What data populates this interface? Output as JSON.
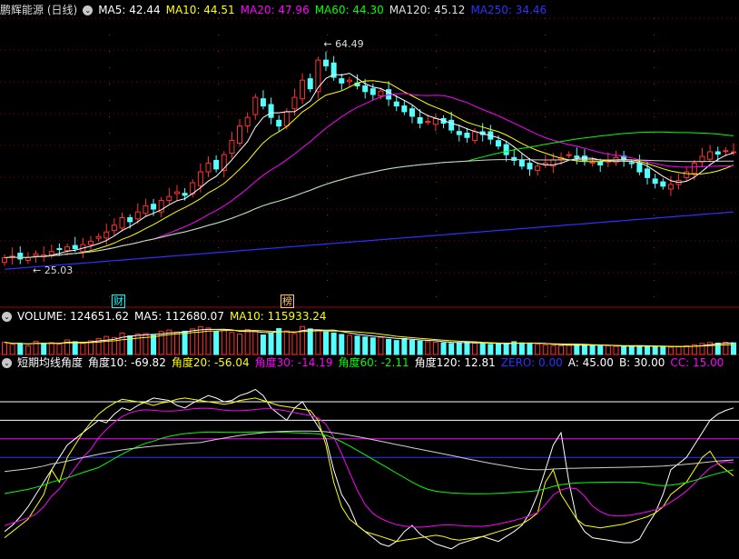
{
  "main": {
    "stock": "鹏辉能源 (日线)",
    "ma": [
      {
        "label": "MA5: 42.44",
        "color": "#ffffff"
      },
      {
        "label": "MA10: 44.51",
        "color": "#ffff00"
      },
      {
        "label": "MA20: 47.96",
        "color": "#ff00ff"
      },
      {
        "label": "MA60: 44.30",
        "color": "#00ff00"
      },
      {
        "label": "MA120: 45.12",
        "color": "#e0e0e0"
      },
      {
        "label": "MA250: 34.46",
        "color": "#3030ff"
      }
    ],
    "high_label": "64.49",
    "low_label": "25.03",
    "tag1": "财",
    "tag2": "榜"
  },
  "volume": {
    "items": [
      {
        "label": "VOLUME: 124651.62",
        "color": "#ffffff"
      },
      {
        "label": "MA5: 112680.07",
        "color": "#ffffff"
      },
      {
        "label": "MA10: 115933.24",
        "color": "#ffff00"
      }
    ]
  },
  "indicator": {
    "items": [
      {
        "label": "短期均线角度",
        "color": "#ffffff"
      },
      {
        "label": "角度10: -69.82",
        "color": "#ffffff"
      },
      {
        "label": "角度20: -56.04",
        "color": "#ffff00"
      },
      {
        "label": "角度30: -14.19",
        "color": "#ff00ff"
      },
      {
        "label": "角度60: -2.11",
        "color": "#00ff00"
      },
      {
        "label": "角度120: 12.81",
        "color": "#ffffff"
      },
      {
        "label": "ZERO: 0.00",
        "color": "#3030ff"
      },
      {
        "label": "A: 45.00",
        "color": "#ffffff"
      },
      {
        "label": "B: 30.00",
        "color": "#ffffff"
      },
      {
        "label": "CC: 15.00",
        "color": "#ff00ff"
      }
    ]
  },
  "chart_data": {
    "type": "candlestick",
    "series": [
      {
        "name": "MA5",
        "last": 42.44
      },
      {
        "name": "MA10",
        "last": 44.51
      },
      {
        "name": "MA20",
        "last": 47.96
      },
      {
        "name": "MA60",
        "last": 44.3
      },
      {
        "name": "MA120",
        "last": 45.12
      },
      {
        "name": "MA250",
        "last": 34.46
      }
    ],
    "close": [
      26.5,
      26.8,
      26.3,
      26.6,
      27.2,
      27.0,
      27.6,
      28.0,
      28.4,
      28.1,
      28.8,
      29.4,
      30.2,
      31.0,
      32.2,
      33.5,
      32.8,
      34.5,
      35.6,
      35.0,
      36.5,
      37.2,
      38.0,
      37.4,
      39.6,
      41.5,
      43.0,
      42.0,
      44.5,
      47.0,
      49.5,
      51.0,
      54.5,
      53.0,
      51.0,
      49.5,
      52.0,
      54.5,
      57.5,
      56.0,
      61.0,
      60.0,
      58.0,
      57.0,
      57.5,
      56.5,
      55.5,
      55.0,
      55.6,
      54.2,
      53.0,
      52.0,
      51.2,
      50.0,
      50.3,
      50.8,
      50.0,
      48.8,
      48.0,
      47.5,
      48.5,
      48.0,
      47.2,
      46.0,
      44.5,
      43.5,
      42.5,
      42.0,
      42.5,
      43.0,
      43.6,
      44.0,
      44.5,
      44.0,
      43.5,
      43.2,
      42.7,
      43.4,
      44.0,
      43.6,
      43.0,
      41.5,
      40.5,
      39.5,
      39.0,
      39.3,
      40.0,
      41.5,
      43.0,
      44.2,
      45.0,
      44.6,
      45.2,
      45.0
    ],
    "volume": [
      4.2,
      3.5,
      3.8,
      3.0,
      4.5,
      3.9,
      4.1,
      3.6,
      5.0,
      4.4,
      3.8,
      4.7,
      5.5,
      6.2,
      5.8,
      7.4,
      6.4,
      7.0,
      7.2,
      6.6,
      7.9,
      8.4,
      7.7,
      8.0,
      8.8,
      9.5,
      9.1,
      7.8,
      8.3,
      7.6,
      7.0,
      8.6,
      7.9,
      6.7,
      7.3,
      8.9,
      8.1,
      7.2,
      9.6,
      8.8,
      8.5,
      7.7,
      7.4,
      6.9,
      6.6,
      6.3,
      6.0,
      5.7,
      5.9,
      5.2,
      4.8,
      5.5,
      4.9,
      4.6,
      4.4,
      4.2,
      4.0,
      3.8,
      4.1,
      4.3,
      3.9,
      3.7,
      3.5,
      3.6,
      3.9,
      4.4,
      4.0,
      3.8,
      3.5,
      3.3,
      3.1,
      3.0,
      3.2,
      3.5,
      3.3,
      3.1,
      2.9,
      3.0,
      2.8,
      2.7,
      2.8,
      3.0,
      2.9,
      2.8,
      2.6,
      2.5,
      2.7,
      3.0,
      3.3,
      3.8,
      4.1,
      3.9,
      4.2,
      4.0
    ],
    "angle10": [
      -60,
      -55,
      -48,
      -40,
      -30,
      -20,
      -10,
      0,
      10,
      15,
      20,
      25,
      30,
      28,
      35,
      40,
      38,
      42,
      45,
      48,
      47,
      46,
      42,
      40,
      44,
      47,
      50,
      48,
      45,
      46,
      50,
      52,
      55,
      50,
      40,
      35,
      30,
      40,
      45,
      35,
      25,
      15,
      -10,
      -30,
      -40,
      -55,
      -60,
      -65,
      -70,
      -72,
      -68,
      -60,
      -55,
      -62,
      -66,
      -70,
      -72,
      -74,
      -70,
      -68,
      -66,
      -64,
      -66,
      -68,
      -64,
      -60,
      -55,
      -45,
      -30,
      -10,
      10,
      20,
      -20,
      -50,
      -60,
      -65,
      -66,
      -67,
      -68,
      -69,
      -69,
      -66,
      -55,
      -45,
      -30,
      -10,
      -5,
      0,
      10,
      20,
      30,
      35,
      38,
      40
    ],
    "angle20": [
      -65,
      -60,
      -55,
      -50,
      -40,
      -30,
      -10,
      -20,
      0,
      10,
      20,
      28,
      35,
      40,
      44,
      47,
      46,
      45,
      44,
      42,
      44,
      45,
      47,
      48,
      47,
      46,
      45,
      44,
      43,
      44,
      46,
      47,
      48,
      46,
      44,
      42,
      41,
      40,
      39,
      38,
      30,
      10,
      -20,
      -40,
      -50,
      -55,
      -60,
      -62,
      -64,
      -66,
      -68,
      -67,
      -66,
      -65,
      -64,
      -63,
      -64,
      -66,
      -67,
      -66,
      -65,
      -64,
      -62,
      -60,
      -58,
      -56,
      -54,
      -50,
      -45,
      -20,
      -10,
      -30,
      -40,
      -50,
      -55,
      -56,
      -57,
      -56,
      -55,
      -54,
      -52,
      -50,
      -48,
      -45,
      -40,
      -30,
      -25,
      -20,
      -10,
      0,
      5,
      -5,
      -10,
      -15
    ]
  }
}
